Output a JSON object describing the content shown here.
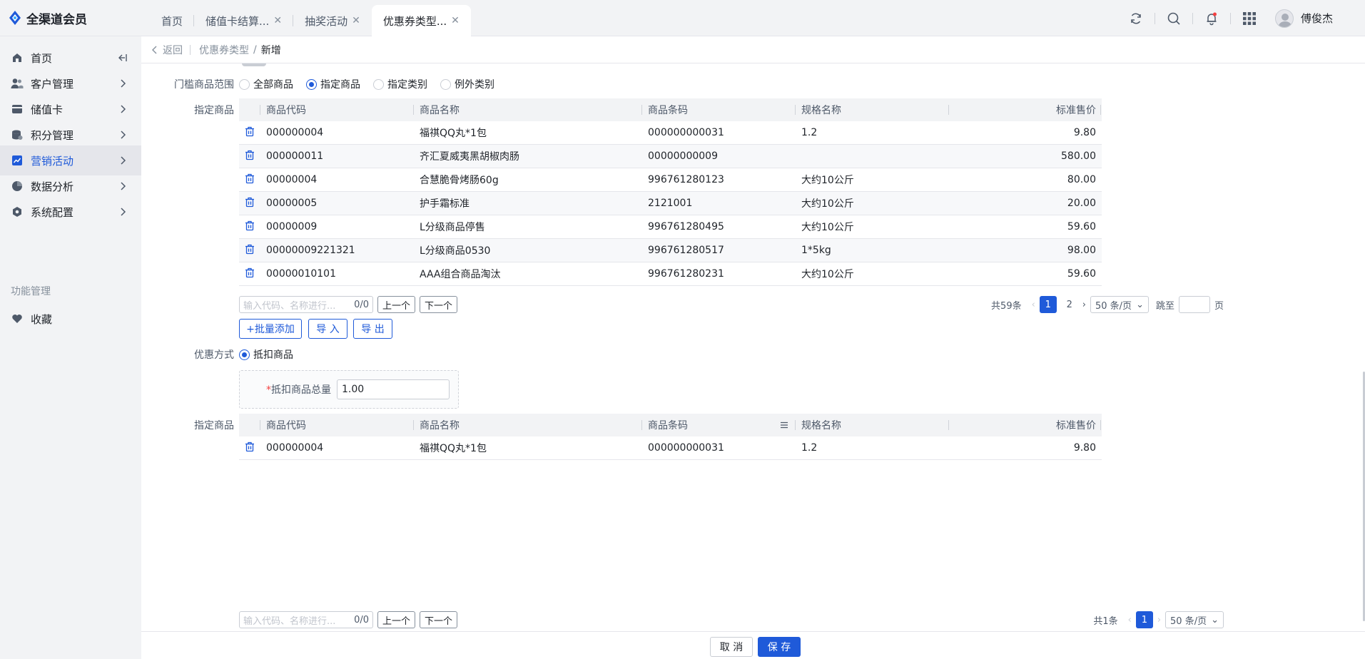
{
  "app": {
    "title": "全渠道会员"
  },
  "tabs": [
    {
      "label": "首页",
      "closable": false
    },
    {
      "label": "储值卡结算...",
      "closable": true
    },
    {
      "label": "抽奖活动",
      "closable": true
    },
    {
      "label": "优惠券类型...",
      "closable": true,
      "active": true
    }
  ],
  "user": {
    "name": "傅俊杰"
  },
  "sidebar": {
    "items": [
      {
        "label": "首页",
        "icon": "home-icon"
      },
      {
        "label": "客户管理",
        "icon": "users-icon"
      },
      {
        "label": "储值卡",
        "icon": "card-icon"
      },
      {
        "label": "积分管理",
        "icon": "points-icon"
      },
      {
        "label": "营销活动",
        "icon": "chart-line-icon",
        "active": true
      },
      {
        "label": "数据分析",
        "icon": "pie-chart-icon"
      },
      {
        "label": "系统配置",
        "icon": "settings-icon"
      }
    ],
    "group_label": "功能管理",
    "fav_label": "收藏"
  },
  "breadcrumb": {
    "back": "返回",
    "parent": "优惠券类型",
    "sep": "/",
    "current": "新增"
  },
  "threshold": {
    "label": "门槛商品范围",
    "options": [
      "全部商品",
      "指定商品",
      "指定类别",
      "例外类别"
    ],
    "selected": "指定商品"
  },
  "table_headers": [
    "商品代码",
    "商品名称",
    "商品条码",
    "规格名称",
    "标准售价"
  ],
  "products1": {
    "label": "指定商品",
    "rows": [
      {
        "code": "000000004",
        "name": "福祺QQ丸*1包",
        "barcode": "000000000031",
        "spec": "1.2",
        "price": "9.80"
      },
      {
        "code": "000000011",
        "name": "齐汇夏威夷黑胡椒肉肠",
        "barcode": "00000000009",
        "spec": "",
        "price": "580.00"
      },
      {
        "code": "00000004",
        "name": "合慧脆骨烤肠60g",
        "barcode": "996761280123",
        "spec": "大约10公斤",
        "price": "80.00"
      },
      {
        "code": "00000005",
        "name": "护手霜标准",
        "barcode": "2121001",
        "spec": "大约10公斤",
        "price": "20.00"
      },
      {
        "code": "00000009",
        "name": "L分级商品停售",
        "barcode": "996761280495",
        "spec": "大约10公斤",
        "price": "59.60"
      },
      {
        "code": "00000009221321",
        "name": "L分级商品0530",
        "barcode": "996761280517",
        "spec": "1*5kg",
        "price": "98.00"
      },
      {
        "code": "00000010101",
        "name": "AAA组合商品淘汰",
        "barcode": "996761280231",
        "spec": "大约10公斤",
        "price": "59.60"
      }
    ],
    "search_placeholder": "输入代码、名称进行...",
    "search_count": "0/0",
    "prev": "上一个",
    "next": "下一个",
    "total": "共59条",
    "pages": [
      "1",
      "2"
    ],
    "page_size": "50 条/页",
    "jump": "跳至",
    "page_unit": "页"
  },
  "actions": {
    "batch_add": "+批量添加",
    "import": "导 入",
    "export": "导 出"
  },
  "discount": {
    "label": "优惠方式",
    "option": "抵扣商品",
    "qty_label": "抵扣商品总量",
    "qty_value": "1.00"
  },
  "products2": {
    "label": "指定商品",
    "rows": [
      {
        "code": "000000004",
        "name": "福祺QQ丸*1包",
        "barcode": "000000000031",
        "spec": "1.2",
        "price": "9.80"
      }
    ],
    "search_placeholder": "输入代码、名称进行...",
    "search_count": "0/0",
    "prev": "上一个",
    "next": "下一个",
    "total": "共1条",
    "pages": [
      "1"
    ],
    "page_size": "50 条/页"
  },
  "footer": {
    "cancel": "取 消",
    "save": "保 存"
  },
  "colors": {
    "primary": "#1f5ad9",
    "sidebar_bg": "#f2f3f5",
    "required": "#f53f3f"
  }
}
